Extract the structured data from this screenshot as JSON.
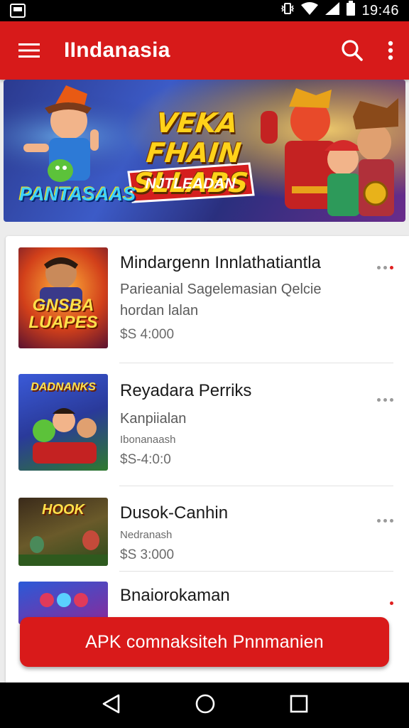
{
  "status_bar": {
    "time": "19:46"
  },
  "app_bar": {
    "title": "IIndanasia",
    "menu_icon": "hamburger-menu-icon",
    "search_icon": "search-icon",
    "overflow_icon": "more-vert-icon"
  },
  "banner": {
    "headline": "VEKA FHAIN SLLABS",
    "ribbon": "NJTLEADAN",
    "logo": "PANTASAAS"
  },
  "items": [
    {
      "title": "Mindargenn Innlathatiantla",
      "subtitle": "Parieanial Sagelemasian Qelcie",
      "subtitle2": "hordan lalan",
      "price": "$S 4:000",
      "thumb_text": "GNSBA LUAPES",
      "menu_icon": "more-horiz-icon"
    },
    {
      "title": "Reyadara Perriks",
      "subtitle": "Kanpiialan",
      "subtitle2": "Ibonanaash",
      "price": "$S-4:0:0",
      "thumb_text": "DADNANKS",
      "menu_icon": "more-horiz-icon"
    },
    {
      "title": "Dusok-Canhin",
      "subtitle2": "Nedranash",
      "price": "$S 3:000",
      "thumb_text": "HOOK",
      "menu_icon": "more-horiz-icon"
    },
    {
      "title": "Bnaiorokaman",
      "menu_icon": "more-horiz-icon"
    }
  ],
  "cta": {
    "label": "APK comnaksiteh Pnnmanien"
  },
  "nav_bar": {
    "back_icon": "back-triangle-icon",
    "home_icon": "home-circle-icon",
    "recents_icon": "recents-square-icon"
  },
  "colors": {
    "primary": "#d71a1a",
    "accent_dot": "#e02020"
  }
}
